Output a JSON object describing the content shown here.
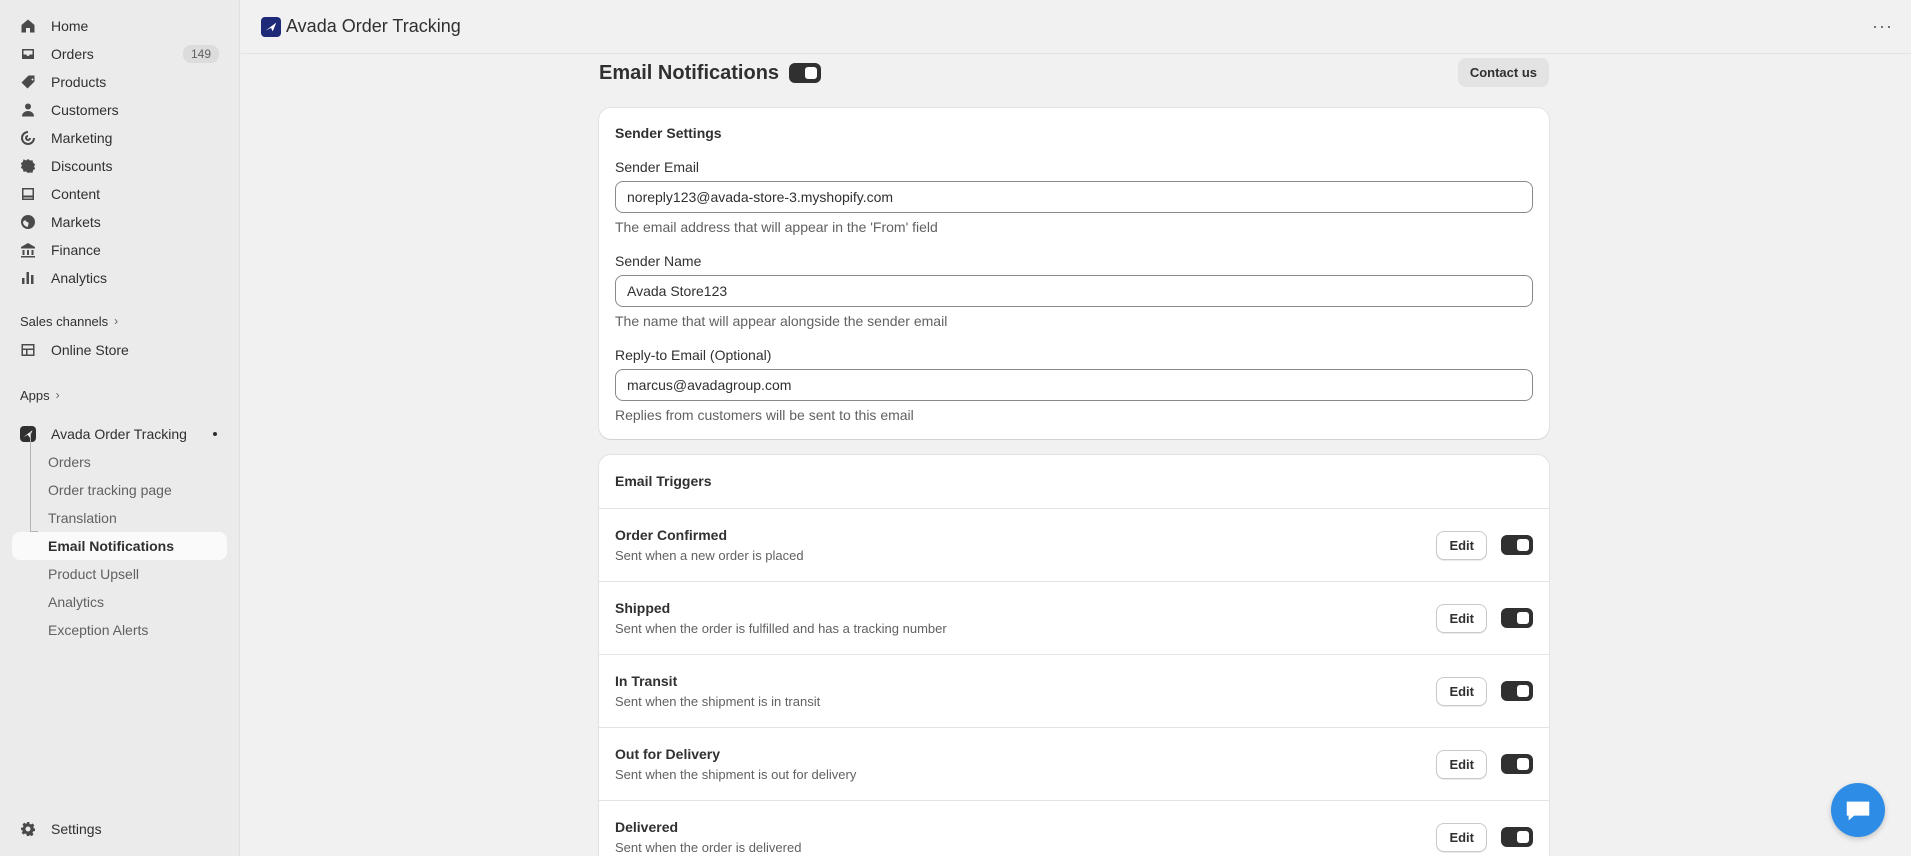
{
  "sidebar": {
    "nav": [
      {
        "label": "Home",
        "icon": "home-icon"
      },
      {
        "label": "Orders",
        "icon": "inbox-icon",
        "count": "149"
      },
      {
        "label": "Products",
        "icon": "tag-icon"
      },
      {
        "label": "Customers",
        "icon": "person-icon"
      },
      {
        "label": "Marketing",
        "icon": "target-icon"
      },
      {
        "label": "Discounts",
        "icon": "discount-icon"
      },
      {
        "label": "Content",
        "icon": "content-icon"
      },
      {
        "label": "Markets",
        "icon": "globe-icon"
      },
      {
        "label": "Finance",
        "icon": "bank-icon"
      },
      {
        "label": "Analytics",
        "icon": "bar-chart-icon"
      }
    ],
    "sales_channels": {
      "label": "Sales channels",
      "items": [
        {
          "label": "Online Store"
        }
      ]
    },
    "apps": {
      "label": "Apps"
    },
    "app": {
      "label": "Avada Order Tracking",
      "sub_items": [
        {
          "label": "Orders"
        },
        {
          "label": "Order tracking page"
        },
        {
          "label": "Translation"
        },
        {
          "label": "Email Notifications"
        },
        {
          "label": "Product Upsell"
        },
        {
          "label": "Analytics"
        },
        {
          "label": "Exception Alerts"
        }
      ]
    },
    "settings": {
      "label": "Settings"
    }
  },
  "header": {
    "title": "Avada Order Tracking",
    "more": "···"
  },
  "page": {
    "title": "Email Notifications",
    "contact": "Contact us",
    "sender_settings": {
      "title": "Sender Settings",
      "fields": [
        {
          "label": "Sender Email",
          "value": "noreply123@avada-store-3.myshopify.com",
          "help": "The email address that will appear in the 'From' field"
        },
        {
          "label": "Sender Name",
          "value": "Avada Store123",
          "help": "The name that will appear alongside the sender email"
        },
        {
          "label": "Reply-to Email (Optional)",
          "value": "marcus@avadagroup.com",
          "help": "Replies from customers will be sent to this email"
        }
      ]
    },
    "triggers": {
      "title": "Email Triggers",
      "edit_label": "Edit",
      "rows": [
        {
          "name": "Order Confirmed",
          "desc": "Sent when a new order is placed"
        },
        {
          "name": "Shipped",
          "desc": "Sent when the order is fulfilled and has a tracking number"
        },
        {
          "name": "In Transit",
          "desc": "Sent when the shipment is in transit"
        },
        {
          "name": "Out for Delivery",
          "desc": "Sent when the shipment is out for delivery"
        },
        {
          "name": "Delivered",
          "desc": "Sent when the order is delivered"
        }
      ]
    }
  }
}
